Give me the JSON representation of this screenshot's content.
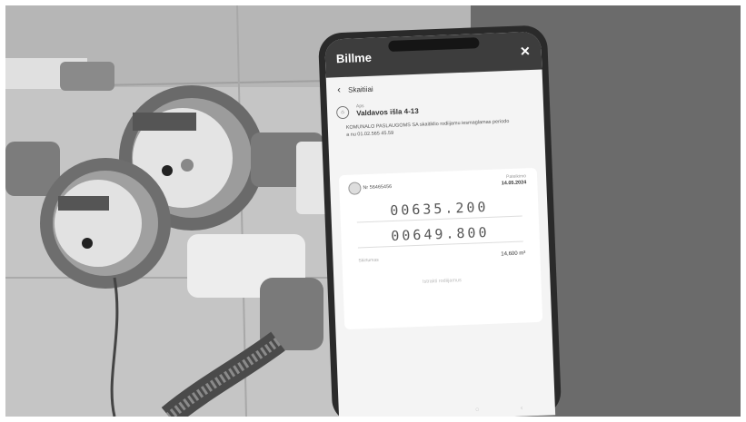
{
  "app": {
    "brand": "Billme",
    "close_icon": "close-icon",
    "back_label": "Skaitiiai"
  },
  "card": {
    "small_label": "Aps",
    "address": "Valdavos išla 4-13",
    "description": "KOMUNALO PASLAUGOMS SA  skaitiklio rodiijamu iesmaglamas periodo a nu 01.02.565 45.59"
  },
  "meter": {
    "number": "Nr 56465456",
    "date_label": "Pateikimo",
    "date_value": "14.05.2024",
    "reading_previous": "00635.200",
    "reading_current": "00649.800",
    "difference_label": "Skirtumas",
    "difference_value": "14,600 m³",
    "link_label": "Istrakti rodiijamus"
  },
  "colors": {
    "phone_body": "#2a2a2a",
    "app_header": "#3d3d3d",
    "screen_bg": "#f4f4f4",
    "side_panel": "#6b6b6b"
  }
}
